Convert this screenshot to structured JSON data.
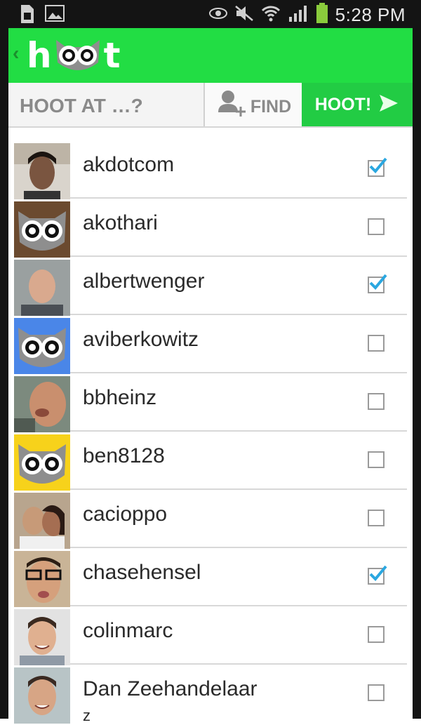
{
  "status": {
    "time": "5:28 PM"
  },
  "app": {
    "logo_letters": [
      "h",
      "t"
    ],
    "hoot_at_label": "HOOT AT …?",
    "find_label": "FIND",
    "hoot_label": "HOOT!"
  },
  "colors": {
    "brand_green": "#22dd44",
    "check_blue": "#2aa7e0"
  },
  "users": [
    {
      "name": "akdotcom",
      "checked": true,
      "avatar": "photo-man-dark-hair"
    },
    {
      "name": "akothari",
      "checked": false,
      "avatar": "owl-brown"
    },
    {
      "name": "albertwenger",
      "checked": true,
      "avatar": "photo-man-bald"
    },
    {
      "name": "aviberkowitz",
      "checked": false,
      "avatar": "owl-blue"
    },
    {
      "name": "bbheinz",
      "checked": false,
      "avatar": "photo-man-closeup"
    },
    {
      "name": "ben8128",
      "checked": false,
      "avatar": "owl-yellow"
    },
    {
      "name": "cacioppo",
      "checked": false,
      "avatar": "photo-couple"
    },
    {
      "name": "chasehensel",
      "checked": true,
      "avatar": "photo-man-glasses"
    },
    {
      "name": "colinmarc",
      "checked": false,
      "avatar": "photo-man-smiling"
    },
    {
      "name": "Dan Zeehandelaar",
      "subtitle": "z",
      "checked": false,
      "avatar": "photo-man-smiling-2"
    }
  ]
}
